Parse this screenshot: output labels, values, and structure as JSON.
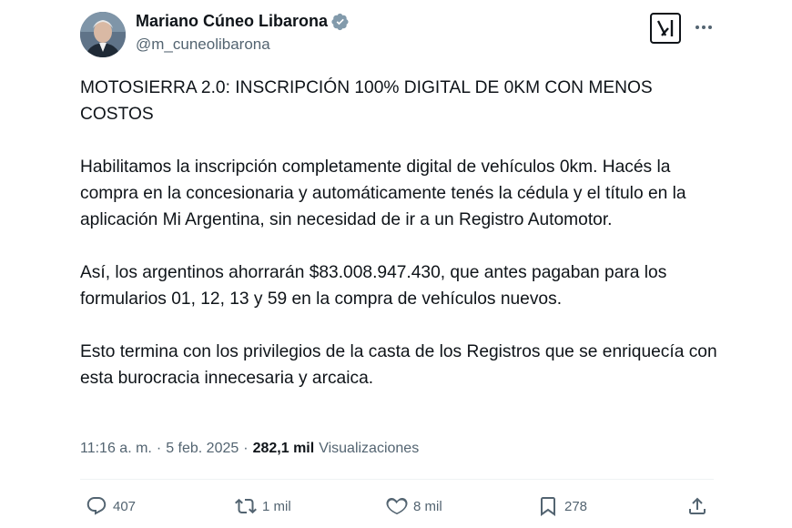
{
  "author": {
    "name": "Mariano Cúneo Libarona",
    "handle": "@m_cuneolibarona"
  },
  "icons": {
    "verified": "verified-badge-icon",
    "grok": "grok-icon",
    "more": "more-icon",
    "reply": "reply-icon",
    "retweet": "retweet-icon",
    "like": "like-icon",
    "bookmark": "bookmark-icon",
    "share": "share-icon"
  },
  "colors": {
    "verified": "#829aab",
    "text": "#0f1419",
    "secondary": "#536471"
  },
  "tweet": {
    "paragraphs": [
      "MOTOSIERRA 2.0: INSCRIPCIÓN 100% DIGITAL DE 0KM CON MENOS COSTOS",
      "Habilitamos la inscripción completamente digital de vehículos 0km. Hacés la compra en la concesionaria y automáticamente tenés la cédula y el título en la aplicación Mi Argentina, sin necesidad de ir a un Registro Automotor.",
      "Así, los argentinos ahorrarán $83.008.947.430, que antes pagaban para los formularios 01, 12, 13 y 59 en la compra de vehículos nuevos.",
      "Esto termina con los privilegios de la casta de los Registros que se enriquecía con esta burocracia innecesaria y arcaica."
    ]
  },
  "meta": {
    "time": "11:16 a. m.",
    "sep": "·",
    "date": "5 feb. 2025",
    "views_count": "282,1 mil",
    "views_label": "Visualizaciones"
  },
  "actions": {
    "replies": "407",
    "reposts": "1 mil",
    "likes": "8 mil",
    "bookmarks": "278"
  }
}
